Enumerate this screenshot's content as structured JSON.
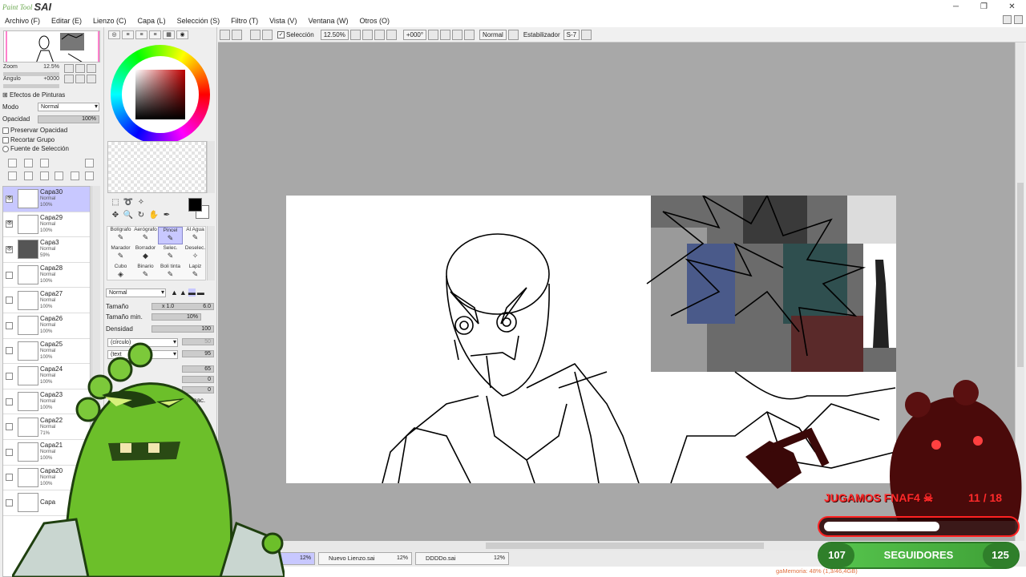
{
  "app": {
    "logo_small": "Paint Tool",
    "logo_big": "SAI"
  },
  "window_controls": {
    "minimize": "─",
    "restore": "❐",
    "close": "✕"
  },
  "menu": [
    "Archivo (F)",
    "Editar (E)",
    "Lienzo (C)",
    "Capa (L)",
    "Selección (S)",
    "Filtro (T)",
    "Vista (V)",
    "Ventana (W)",
    "Otros (O)"
  ],
  "navigator": {
    "zoom_label": "Zoom",
    "zoom_value": "12.5%",
    "angle_label": "Angulo",
    "angle_value": "+0000"
  },
  "layer_props": {
    "effects_label": "Efectos de Pinturas",
    "mode_label": "Modo",
    "mode_value": "Normal",
    "opacity_label": "Opacidad",
    "opacity_value": "100%",
    "preserve_opacity": "Preservar Opacidad",
    "clip_group": "Recortar Grupo",
    "selection_source": "Fuente de Selección"
  },
  "layers": [
    {
      "name": "Capa30",
      "mode": "Normal",
      "opacity": "100%",
      "visible": true,
      "active": true
    },
    {
      "name": "Capa29",
      "mode": "Normal",
      "opacity": "100%",
      "visible": true,
      "active": false
    },
    {
      "name": "Capa3",
      "mode": "Normal",
      "opacity": "59%",
      "visible": true,
      "active": false
    },
    {
      "name": "Capa28",
      "mode": "Normal",
      "opacity": "100%",
      "visible": false,
      "active": false
    },
    {
      "name": "Capa27",
      "mode": "Normal",
      "opacity": "100%",
      "visible": false,
      "active": false
    },
    {
      "name": "Capa26",
      "mode": "Normal",
      "opacity": "100%",
      "visible": false,
      "active": false
    },
    {
      "name": "Capa25",
      "mode": "Normal",
      "opacity": "100%",
      "visible": false,
      "active": false
    },
    {
      "name": "Capa24",
      "mode": "Normal",
      "opacity": "100%",
      "visible": false,
      "active": false
    },
    {
      "name": "Capa23",
      "mode": "Normal",
      "opacity": "100%",
      "visible": false,
      "active": false
    },
    {
      "name": "Capa22",
      "mode": "Normal",
      "opacity": "71%",
      "visible": false,
      "active": false
    },
    {
      "name": "Capa21",
      "mode": "Normal",
      "opacity": "100%",
      "visible": false,
      "active": false
    },
    {
      "name": "Capa20",
      "mode": "Normal",
      "opacity": "100%",
      "visible": false,
      "active": false
    },
    {
      "name": "Capa",
      "mode": "",
      "opacity": "",
      "visible": false,
      "active": false
    }
  ],
  "brushes": [
    {
      "name": "Bolígrafo",
      "selected": false
    },
    {
      "name": "Aerógrafo",
      "selected": false
    },
    {
      "name": "Pincel",
      "selected": true
    },
    {
      "name": "Al Agua",
      "selected": false
    },
    {
      "name": "Marador",
      "selected": false
    },
    {
      "name": "Borrador",
      "selected": false
    },
    {
      "name": "Selec.",
      "selected": false
    },
    {
      "name": "Deselec.",
      "selected": false
    },
    {
      "name": "Cubo",
      "selected": false
    },
    {
      "name": "Binario",
      "selected": false
    },
    {
      "name": "Boli tinta",
      "selected": false
    },
    {
      "name": "Lapiz",
      "selected": false
    }
  ],
  "brush_props": {
    "blend_mode": "Normal",
    "size_label": "Tamaño",
    "size_mult": "x 1.0",
    "size_value": "6.0",
    "min_size_label": "Tamaño min.",
    "min_size_value": "10%",
    "density_label": "Densidad",
    "density_value": "100",
    "shape_select": "(círculo)",
    "shape_value": "50",
    "texture_select": "(text",
    "texture_value": "95",
    "value_65": "65",
    "value_0a": "0",
    "value_0b": "0",
    "spac_label": "pac."
  },
  "toolbar": {
    "selection_label": "Selección",
    "zoom": "12.50%",
    "angle": "+000°",
    "blend": "Normal",
    "stabilizer_label": "Estabilizador",
    "stabilizer_value": "S-7"
  },
  "file_tabs": [
    {
      "name": "",
      "zoom": "12%",
      "active": true
    },
    {
      "name": "Nuevo Lienzo.sai",
      "zoom": "12%",
      "active": false
    },
    {
      "name": "DDDDo.sai",
      "zoom": "12%",
      "active": false
    }
  ],
  "status": {
    "memory": "gaMemoria: 48% (1,3/46,4GB)"
  },
  "stream_overlay": {
    "goal_label": "JUGAMOS FNAF4",
    "goal_progress": "11 / 18",
    "goal_fraction": 0.61,
    "followers_current": "107",
    "followers_label": "SEGUIDORES",
    "followers_target": "125"
  },
  "colors": {
    "selection_blue": "#c8c8ff",
    "overlay_red": "#ff2a2a",
    "overlay_green": "#57c64e",
    "canvas_bg": "#a8a8a8"
  }
}
